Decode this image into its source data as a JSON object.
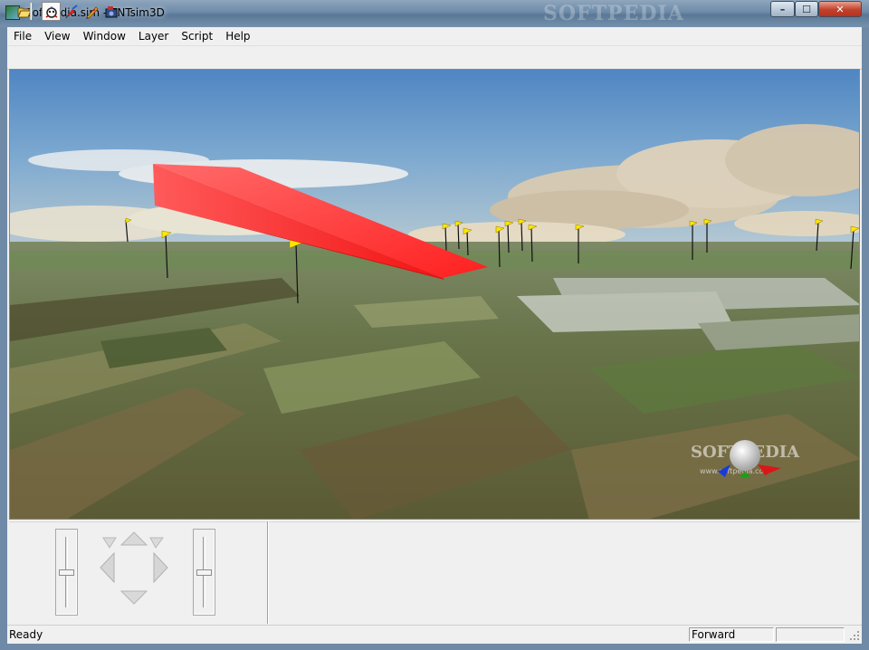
{
  "window": {
    "title": "Softpedia.sim - TNTsim3D",
    "watermark": "SOFTPEDIA",
    "controls": {
      "minimize": "–",
      "maximize": "☐",
      "close": "✕"
    }
  },
  "menubar": {
    "items": [
      {
        "id": "file",
        "label": "File"
      },
      {
        "id": "view",
        "label": "View"
      },
      {
        "id": "window",
        "label": "Window"
      },
      {
        "id": "layer",
        "label": "Layer"
      },
      {
        "id": "script",
        "label": "Script"
      },
      {
        "id": "help",
        "label": "Help"
      }
    ]
  },
  "toolbar": {
    "buttons": [
      {
        "id": "open",
        "icon": "folder-open-icon"
      },
      {
        "id": "navigate",
        "icon": "walk-icon",
        "selected": true
      },
      {
        "id": "fly",
        "icon": "fly-icon"
      },
      {
        "id": "pick",
        "icon": "pencil-icon"
      },
      {
        "id": "record",
        "icon": "camera-icon"
      }
    ]
  },
  "viewport": {
    "overlay_watermark": "SOFTPEDIA",
    "overlay_url": "www.softpedia.com",
    "colors": {
      "sky_top": "#4f86c2",
      "ground": "#6d7a4c",
      "arrow": "#ff2a2a",
      "flag": "#ffe600"
    }
  },
  "controls": {
    "left_slider_value": 0.5,
    "right_slider_value": 0.5,
    "nav_pad": {
      "up": "up-arrow-icon",
      "down": "down-arrow-icon",
      "left": "left-arrow-icon",
      "right": "right-arrow-icon"
    }
  },
  "statusbar": {
    "status": "Ready",
    "mode": "Forward",
    "extra": ""
  }
}
